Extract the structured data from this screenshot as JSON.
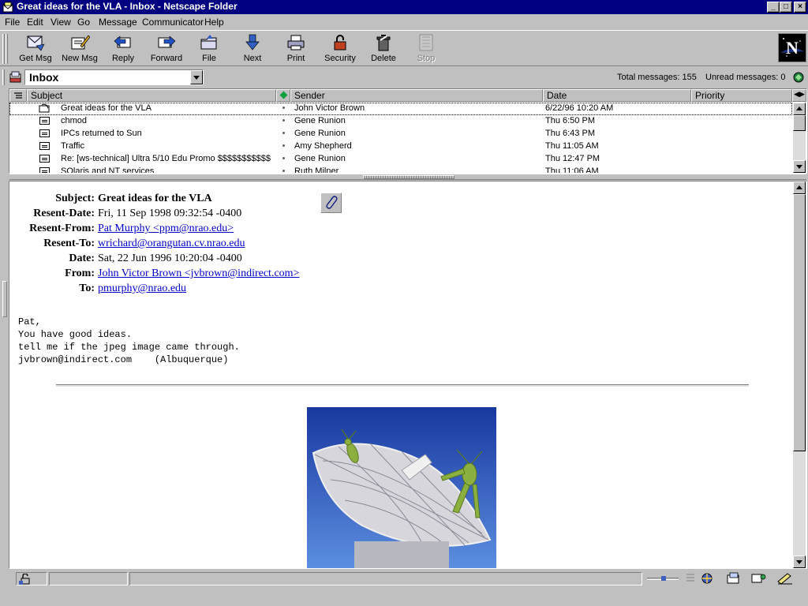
{
  "window": {
    "title": "Great ideas for the VLA - Inbox - Netscape Folder",
    "controls": [
      "_",
      "□",
      "×"
    ]
  },
  "menu": [
    "File",
    "Edit",
    "View",
    "Go",
    "Message",
    "Communicator",
    "Help"
  ],
  "toolbar": {
    "buttons": [
      {
        "label": "Get Msg",
        "icon": "get-msg-icon"
      },
      {
        "label": "New Msg",
        "icon": "new-msg-icon"
      },
      {
        "label": "Reply",
        "icon": "reply-icon"
      },
      {
        "label": "Forward",
        "icon": "forward-icon"
      },
      {
        "label": "File",
        "icon": "file-folder-icon"
      },
      {
        "label": "Next",
        "icon": "next-arrow-icon"
      },
      {
        "label": "Print",
        "icon": "printer-icon"
      },
      {
        "label": "Security",
        "icon": "padlock-icon"
      },
      {
        "label": "Delete",
        "icon": "trash-icon"
      },
      {
        "label": "Stop",
        "icon": "stop-icon",
        "disabled": true
      }
    ]
  },
  "location": {
    "folder": "Inbox",
    "total": "Total messages: 155",
    "unread": "Unread messages: 0"
  },
  "message_list": {
    "columns": [
      "Subject",
      "Sender",
      "Date",
      "Priority"
    ],
    "rows": [
      {
        "subject": "Great ideas for the VLA",
        "sender": "John Victor Brown",
        "date": "6/22/96 10:20 AM",
        "selected": true
      },
      {
        "subject": "chmod",
        "sender": "Gene Runion",
        "date": "Thu 6:50 PM"
      },
      {
        "subject": "IPCs returned to Sun",
        "sender": "Gene Runion",
        "date": "Thu 6:43 PM"
      },
      {
        "subject": "Traffic",
        "sender": "Amy Shepherd",
        "date": "Thu 11:05 AM"
      },
      {
        "subject": "Re: [ws-technical] Ultra 5/10 Edu Promo $$$$$$$$$$$",
        "sender": "Gene Runion",
        "date": "Thu 12:47 PM"
      },
      {
        "subject": "SOlaris and NT services",
        "sender": "Ruth Milner",
        "date": "Thu 11:06 AM"
      }
    ]
  },
  "message": {
    "headers": [
      {
        "label": "Subject:",
        "value": "Great ideas for the VLA",
        "bold": true
      },
      {
        "label": "Resent-Date:",
        "value": "Fri, 11 Sep 1998 09:32:54 -0400"
      },
      {
        "label": "Resent-From:",
        "value": "Pat Murphy <ppm@nrao.edu>",
        "link": true
      },
      {
        "label": "Resent-To:",
        "value": "wrichard@orangutan.cv.nrao.edu",
        "link": true
      },
      {
        "label": "Date:",
        "value": "Sat, 22 Jun 1996 10:20:04 -0400"
      },
      {
        "label": "From:",
        "value": "John Victor Brown <jvbrown@indirect.com>",
        "link": true
      },
      {
        "label": "To:",
        "value": "pmurphy@nrao.edu",
        "link": true
      }
    ],
    "body": [
      "Pat,",
      "You have good ideas.",
      "tell me if the jpeg image came through.",
      "jvbrown@indirect.com    (Albuquerque)"
    ],
    "attachment_icon": "paperclip-icon"
  },
  "colors": {
    "titlebar": "#000080",
    "chrome": "#c0c0c0",
    "link": "#0000cc"
  }
}
